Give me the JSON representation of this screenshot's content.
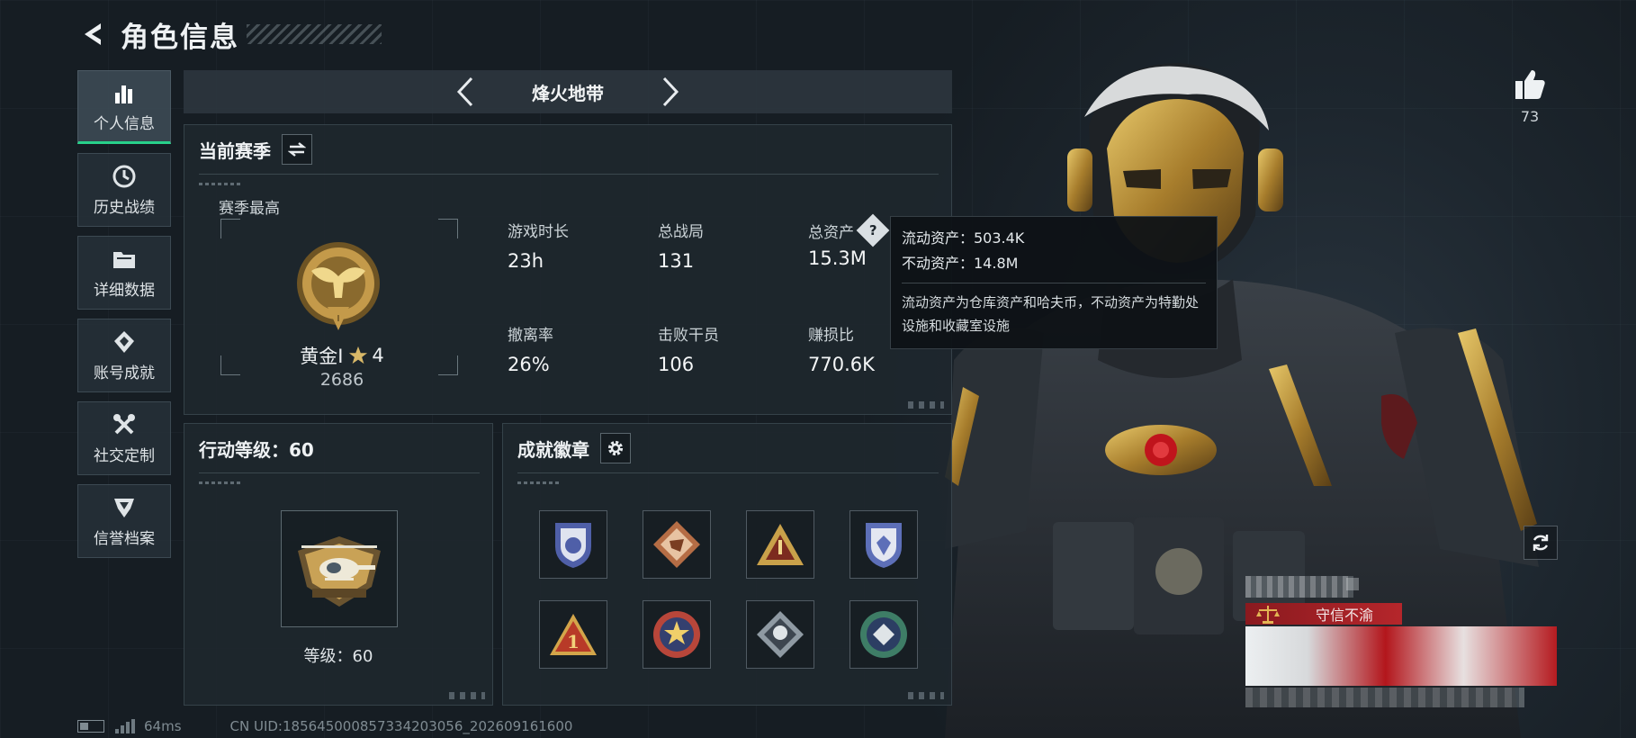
{
  "header": {
    "title": "角色信息"
  },
  "nav": {
    "items": [
      {
        "label": "个人信息",
        "icon": "bar-chart-icon",
        "active": true
      },
      {
        "label": "历史战绩",
        "icon": "clock-icon",
        "active": false
      },
      {
        "label": "详细数据",
        "icon": "folder-icon",
        "active": false
      },
      {
        "label": "账号成就",
        "icon": "achievement-icon",
        "active": false
      },
      {
        "label": "社交定制",
        "icon": "tools-icon",
        "active": false
      },
      {
        "label": "信誉档案",
        "icon": "shield-icon",
        "active": false
      }
    ]
  },
  "mode": {
    "title": "烽火地带"
  },
  "season": {
    "title": "当前赛季",
    "best_label": "赛季最高",
    "rank_name": "黄金I",
    "rank_stars": "4",
    "rank_score": "2686",
    "stats": [
      {
        "label": "游戏时长",
        "value": "23h"
      },
      {
        "label": "总战局",
        "value": "131"
      },
      {
        "label": "总资产",
        "value": "15.3M",
        "has_help": true
      },
      {
        "label": "撤离率",
        "value": "26%"
      },
      {
        "label": "击败干员",
        "value": "106"
      },
      {
        "label": "赚损比",
        "value": "770.6K"
      }
    ]
  },
  "tooltip": {
    "liquid": "流动资产：503.4K",
    "fixed": "不动资产：14.8M",
    "note": "流动资产为仓库资产和哈夫币，不动资产为特勤处设施和收藏室设施"
  },
  "action": {
    "title": "行动等级：60",
    "level_text": "等级：60"
  },
  "badges": {
    "title": "成就徽章",
    "items": [
      {
        "name": "badge-shield-blue-icon",
        "color": "#4f5fa8"
      },
      {
        "name": "badge-diamond-copper-icon",
        "color": "#b56d45"
      },
      {
        "name": "badge-triangle-gold-icon",
        "color": "#c9a14a"
      },
      {
        "name": "badge-shield-blue-2-icon",
        "color": "#5d6fb8"
      },
      {
        "name": "badge-triangle-one-icon",
        "color": "#d3a54a"
      },
      {
        "name": "badge-round-star-icon",
        "color": "#b8463a"
      },
      {
        "name": "badge-diamond-silver-icon",
        "color": "#8f9aa3"
      },
      {
        "name": "badge-round-green-icon",
        "color": "#3e7d66"
      }
    ]
  },
  "character": {
    "likes": "73",
    "honor": "守信不渝"
  },
  "footer": {
    "ping": "64ms",
    "uid": "CN UID:185645000857334203056_202609161600"
  },
  "colors": {
    "accent": "#28d08a",
    "gold": "#c9a14a",
    "honor_red": "#b5262b"
  }
}
